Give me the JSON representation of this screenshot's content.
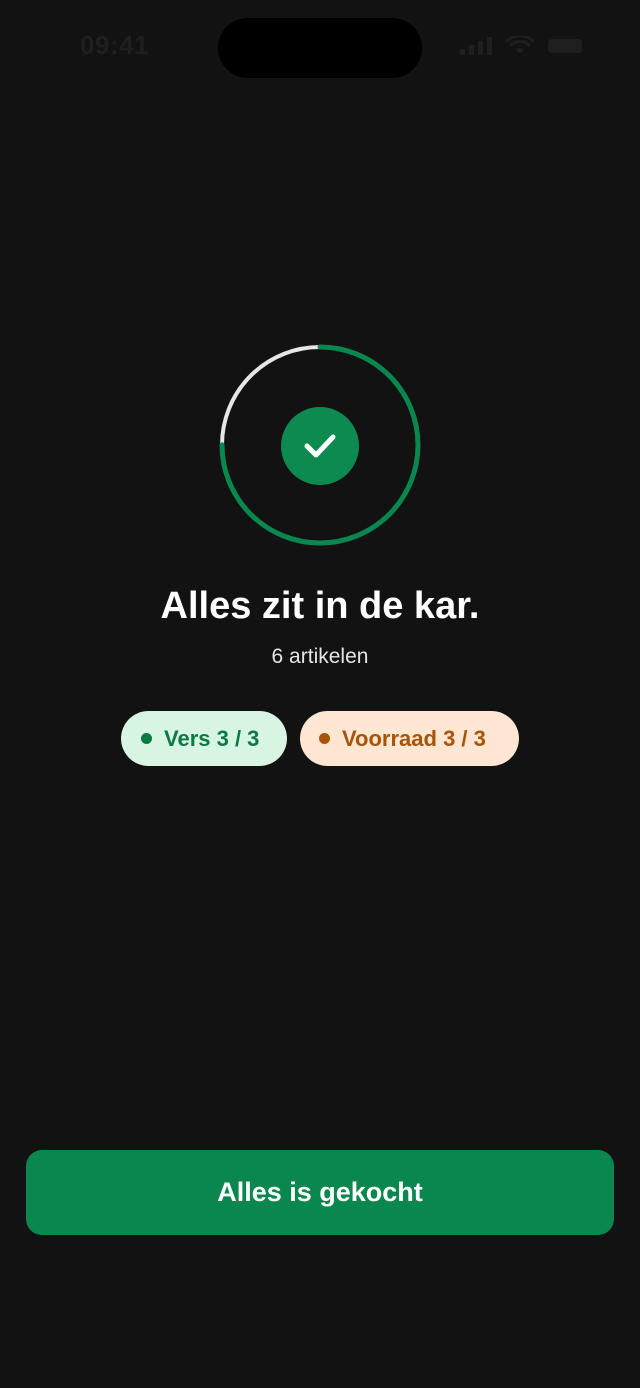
{
  "status_bar": {
    "time": "09:41"
  },
  "progress": {
    "fraction": 0.75,
    "track_color": "#e6e6e6",
    "fill_color": "#0a874e"
  },
  "header": {
    "title": "Alles zit in de kar.",
    "subtitle": "6 artikelen"
  },
  "badges": [
    {
      "label": "Vers 3 / 3",
      "color": "#0a7a45",
      "background": "#d8f4e3"
    },
    {
      "label": "Voorraad 3 / 3",
      "color": "#a85408",
      "background": "#fde6d2"
    }
  ],
  "actions": {
    "primary_label": "Alles is gekocht"
  },
  "icons": {
    "check": "check-icon",
    "signal": "signal-icon",
    "wifi": "wifi-icon",
    "battery": "battery-icon"
  }
}
